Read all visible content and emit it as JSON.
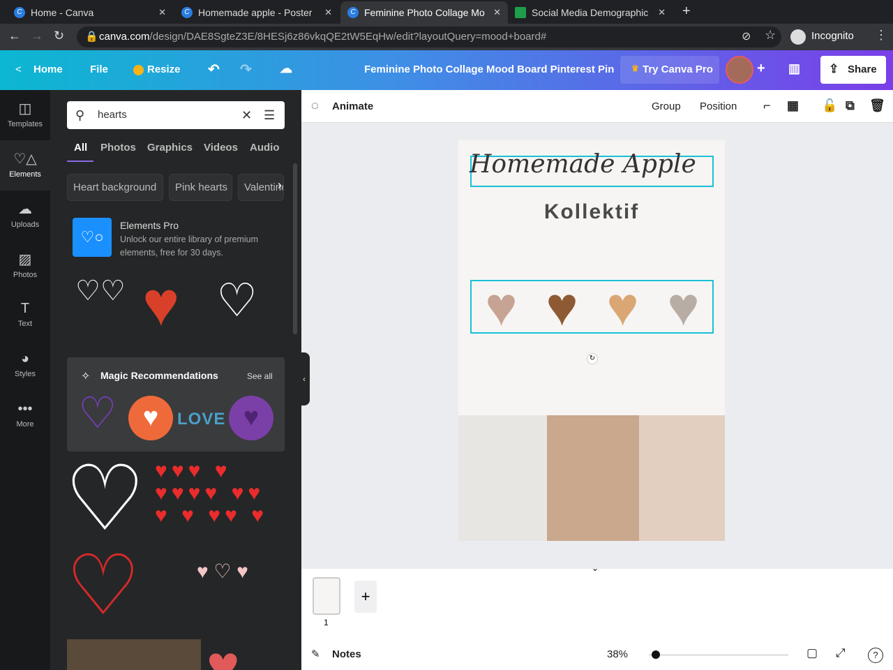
{
  "browser": {
    "tabs": [
      {
        "title": "Home - Canva"
      },
      {
        "title": "Homemade apple - Poster"
      },
      {
        "title": "Feminine Photo Collage Mo"
      },
      {
        "title": "Social Media Demographic"
      }
    ],
    "url_host": "canva.com",
    "url_path": "/design/DAE8SgteZ3E/8HESj6z86vkqQE2tW5EqHw/edit?layoutQuery=mood+board#",
    "profile": "Incognito"
  },
  "header": {
    "home": "Home",
    "file": "File",
    "resize": "Resize",
    "title": "Feminine Photo Collage Mood Board Pinterest Pin",
    "try_pro": "Try Canva Pro",
    "share": "Share"
  },
  "rail": [
    {
      "label": "Templates"
    },
    {
      "label": "Elements"
    },
    {
      "label": "Uploads"
    },
    {
      "label": "Photos"
    },
    {
      "label": "Text"
    },
    {
      "label": "Styles"
    },
    {
      "label": "More"
    }
  ],
  "panel": {
    "search_value": "hearts",
    "tabs": [
      "All",
      "Photos",
      "Graphics",
      "Videos",
      "Audio"
    ],
    "chips": [
      "Heart background",
      "Pink hearts",
      "Valentines"
    ],
    "promo_title": "Elements Pro",
    "promo_desc": "Unlock our entire library of premium elements, free for 30 days.",
    "magic_title": "Magic Recommendations",
    "see_all": "See all",
    "love": "LOVE"
  },
  "toolbar": {
    "animate": "Animate",
    "group": "Group",
    "position": "Position"
  },
  "design": {
    "title": "Homemade Apple",
    "subtitle": "Kollektif",
    "swatches": [
      "#c6a393",
      "#8e5a34",
      "#d9a674",
      "#b8ada5"
    ]
  },
  "pages": {
    "page_number": "1"
  },
  "footer": {
    "notes": "Notes",
    "zoom": "38%",
    "zoom_fraction": 0.05
  }
}
